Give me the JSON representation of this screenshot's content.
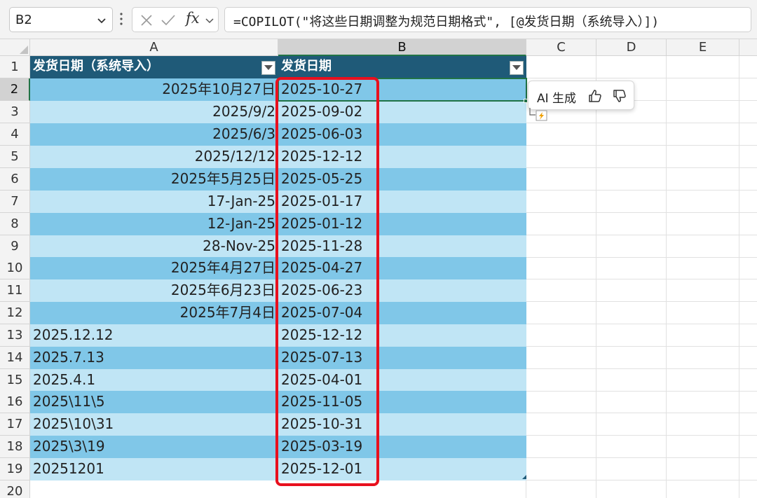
{
  "formula_bar": {
    "name_box": "B2",
    "fx_label": "fx",
    "formula": "=COPILOT(\"将这些日期调整为规范日期格式\", [@发货日期（系统导入）])"
  },
  "column_headers": [
    "A",
    "B",
    "C",
    "D",
    "E"
  ],
  "row_headers": [
    "1",
    "2",
    "3",
    "4",
    "5",
    "6",
    "7",
    "8",
    "9",
    "10",
    "11",
    "12",
    "13",
    "14",
    "15",
    "16",
    "17",
    "18",
    "19",
    "20"
  ],
  "table": {
    "header_a": "发货日期（系统导入）",
    "header_b": "发货日期",
    "rows": [
      {
        "a": "2025年10月27日",
        "b": "2025-10-27"
      },
      {
        "a": "2025/9/2",
        "b": "2025-09-02"
      },
      {
        "a": "2025/6/3",
        "b": "2025-06-03"
      },
      {
        "a": "2025/12/12",
        "b": "2025-12-12"
      },
      {
        "a": "2025年5月25日",
        "b": "2025-05-25"
      },
      {
        "a": "17-Jan-25",
        "b": "2025-01-17"
      },
      {
        "a": "12-Jan-25",
        "b": "2025-01-12"
      },
      {
        "a": "28-Nov-25",
        "b": "2025-11-28"
      },
      {
        "a": "2025年4月27日",
        "b": "2025-04-27"
      },
      {
        "a": "2025年6月23日",
        "b": "2025-06-23"
      },
      {
        "a": "2025年7月4日",
        "b": "2025-07-04"
      },
      {
        "a": "2025.12.12",
        "b": "2025-12-12"
      },
      {
        "a": "2025.7.13",
        "b": "2025-07-13"
      },
      {
        "a": "2025.4.1",
        "b": "2025-04-01"
      },
      {
        "a": "2025\\11\\5",
        "b": "2025-11-05"
      },
      {
        "a": "2025\\10\\31",
        "b": "2025-10-31"
      },
      {
        "a": "2025\\3\\19",
        "b": "2025-03-19"
      },
      {
        "a": "20251201",
        "b": "2025-12-01"
      }
    ]
  },
  "ai_popup": {
    "label": "AI 生成",
    "icons": [
      "thumbs-up-icon",
      "thumbs-down-icon"
    ]
  },
  "colors": {
    "header_fill": "#1f5a78",
    "band_dark": "#80c7e8",
    "band_light": "#c0e5f5",
    "highlight_border": "#e8101e",
    "selection_green": "#217346"
  }
}
